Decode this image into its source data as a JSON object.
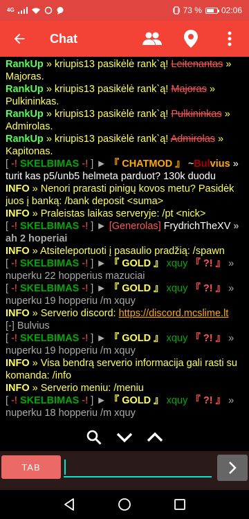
{
  "status_bar": {
    "network": "4G",
    "battery": "73 %",
    "battery_level_pct": 73,
    "time": "02:06"
  },
  "app_bar": {
    "title": "Chat",
    "icons": [
      "arrow-back-icon",
      "people-icon",
      "location-pin-icon",
      "more-vert-icon"
    ]
  },
  "chat": [
    [
      {
        "t": "RankUp",
        "c": "g b"
      },
      {
        "t": " » kriupis13 pasikėlė rank`ą! ",
        "c": "y"
      },
      {
        "t": "Leitenantas",
        "c": "r s"
      },
      {
        "t": " » Majoras.",
        "c": "y"
      }
    ],
    [
      {
        "t": "RankUp",
        "c": "g b"
      },
      {
        "t": " » kriupis13 pasikėlė rank`ą! ",
        "c": "y"
      },
      {
        "t": "Majoras",
        "c": "r s"
      },
      {
        "t": " » Pulkininkas.",
        "c": "y"
      }
    ],
    [
      {
        "t": "RankUp",
        "c": "g b"
      },
      {
        "t": " » kriupis13 pasikėlė rank`ą! ",
        "c": "y"
      },
      {
        "t": "Pulkininkas",
        "c": "r s"
      },
      {
        "t": " » Admirolas.",
        "c": "y"
      }
    ],
    [
      {
        "t": "RankUp",
        "c": "g b"
      },
      {
        "t": " » kriupis13 pasikėlė rank`ą! ",
        "c": "y"
      },
      {
        "t": "Admirolas",
        "c": "r s"
      },
      {
        "t": " » Kapitonas.",
        "c": "y"
      }
    ],
    [
      {
        "t": "[ ",
        "c": "gr"
      },
      {
        "t": "-!",
        "c": "r"
      },
      {
        "t": " SKELBIMAS ",
        "c": "dg b"
      },
      {
        "t": "-!",
        "c": "r"
      },
      {
        "t": " ] ► ",
        "c": "gr"
      },
      {
        "t": "『 CHATMOD 』",
        "c": "o b"
      },
      {
        "t": " ~",
        "c": "w"
      },
      {
        "t": "Bul",
        "c": "dr b"
      },
      {
        "t": "vius",
        "c": "o b"
      },
      {
        "t": " » turit kas p5/unb5 helmeta parduot? 130k duodu",
        "c": "w"
      }
    ],
    [
      {
        "t": "INFO",
        "c": "y b"
      },
      {
        "t": " » Nenori prarasti pinigų kovos metu? Pasidėk juos į banką: /bank deposit <suma>",
        "c": "y"
      }
    ],
    [
      {
        "t": "INFO",
        "c": "y b"
      },
      {
        "t": " » Praleistas laikas serveryje: /pt <nick>",
        "c": "y"
      }
    ],
    [
      {
        "t": "[ ",
        "c": "gr"
      },
      {
        "t": "-!",
        "c": "r"
      },
      {
        "t": " SKELBIMAS ",
        "c": "dg b"
      },
      {
        "t": "-!",
        "c": "r"
      },
      {
        "t": " ] ► ",
        "c": "gr"
      },
      {
        "t": "[Generolas]",
        "c": "r"
      },
      {
        "t": " FrydrichTheXV ",
        "c": "w"
      },
      {
        "t": " » ah 2 hoperiai",
        "c": "gr b"
      }
    ],
    [
      {
        "t": "INFO",
        "c": "y b"
      },
      {
        "t": " » Atsiteleportuoti į pasaulio pradžią: /spawn",
        "c": "y"
      }
    ],
    [
      {
        "t": "[ ",
        "c": "gr"
      },
      {
        "t": "-!",
        "c": "r"
      },
      {
        "t": " SKELBIMAS ",
        "c": "dg b"
      },
      {
        "t": "-!",
        "c": "r"
      },
      {
        "t": " ] ► ",
        "c": "gr"
      },
      {
        "t": "『 GOLD 』",
        "c": "y b"
      },
      {
        "t": " xquy ",
        "c": "dg"
      },
      {
        "t": "『 ?! 』",
        "c": "r b"
      },
      {
        "t": " » nuperku 22 hopperius mazuciai",
        "c": "gr"
      }
    ],
    [
      {
        "t": "[ ",
        "c": "gr"
      },
      {
        "t": "-!",
        "c": "r"
      },
      {
        "t": " SKELBIMAS ",
        "c": "dg b"
      },
      {
        "t": "-!",
        "c": "r"
      },
      {
        "t": " ] ► ",
        "c": "gr"
      },
      {
        "t": "『 GOLD 』",
        "c": "y b"
      },
      {
        "t": " xquy ",
        "c": "dg"
      },
      {
        "t": "『 ?! 』",
        "c": "r b"
      },
      {
        "t": " » nuperku 19 hopperiu /m xquy",
        "c": "gr"
      }
    ],
    [
      {
        "t": "INFO",
        "c": "y b"
      },
      {
        "t": " » Serverio discord: ",
        "c": "y"
      },
      {
        "t": "https://discord.mcslime.lt",
        "c": "o u"
      }
    ],
    [
      {
        "t": "[-] Bulvius",
        "c": "gr"
      }
    ],
    [
      {
        "t": "[ ",
        "c": "gr"
      },
      {
        "t": "-!",
        "c": "r"
      },
      {
        "t": " SKELBIMAS ",
        "c": "dg b"
      },
      {
        "t": "-!",
        "c": "r"
      },
      {
        "t": " ] ► ",
        "c": "gr"
      },
      {
        "t": "『 GOLD 』",
        "c": "y b"
      },
      {
        "t": " xquy ",
        "c": "dg"
      },
      {
        "t": "『 ?! 』",
        "c": "r b"
      },
      {
        "t": " » nuperku 19 hopperiu /m xquy",
        "c": "gr"
      }
    ],
    [
      {
        "t": "INFO",
        "c": "y b"
      },
      {
        "t": " » Visa bendrą serverio informacija gali rasti su komanda: /info",
        "c": "y"
      }
    ],
    [
      {
        "t": "INFO",
        "c": "y b"
      },
      {
        "t": " » Serverio meniu: /meniu",
        "c": "y"
      }
    ],
    [
      {
        "t": "[ ",
        "c": "gr"
      },
      {
        "t": "-!",
        "c": "r"
      },
      {
        "t": " SKELBIMAS ",
        "c": "dg b"
      },
      {
        "t": "-!",
        "c": "r"
      },
      {
        "t": " ] ► ",
        "c": "gr"
      },
      {
        "t": "『 GOLD 』",
        "c": "y b"
      },
      {
        "t": " xquy ",
        "c": "dg"
      },
      {
        "t": "『 ?! 』",
        "c": "r b"
      },
      {
        "t": " » nuperku 18 hopperiu /m xquy",
        "c": "gr"
      }
    ]
  ],
  "toolbar": {
    "icons": [
      "search-icon",
      "chevron-down-icon",
      "chevron-up-icon"
    ]
  },
  "input_bar": {
    "tab_label": "TAB",
    "message_value": "",
    "message_placeholder": "",
    "send_icon": "chevron-right-icon"
  },
  "nav_bar": {
    "icons": [
      "back-triangle-icon",
      "home-circle-icon",
      "recents-square-icon"
    ]
  },
  "colors": {
    "app_bar": "#f44336",
    "status_bar": "#e0463f",
    "tab_button": "#ec6a66",
    "input_underline": "#00e5c8"
  }
}
